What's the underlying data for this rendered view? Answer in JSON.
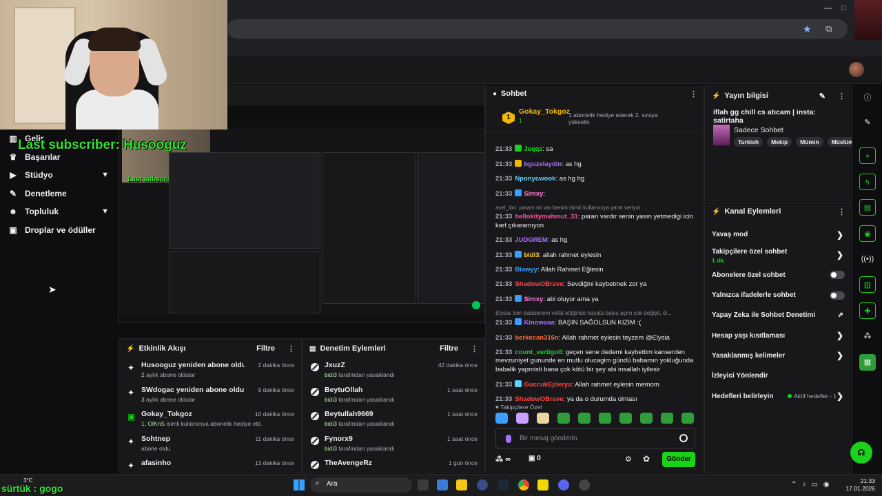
{
  "overlay": {
    "last_subscriber": "Last subscriber: Husooguz",
    "bottom_text": "sürtük : gogo",
    "weather_temp": "3°C"
  },
  "nav": {
    "items": [
      {
        "label": "Gelir",
        "icon": "chart-icon",
        "has_chevron": false
      },
      {
        "label": "Başarılar",
        "icon": "trophy-icon",
        "has_chevron": false
      },
      {
        "label": "Stüdyo",
        "icon": "video-icon",
        "has_chevron": true
      },
      {
        "label": "Denetleme",
        "icon": "wrench-icon",
        "has_chevron": false
      },
      {
        "label": "Topluluk",
        "icon": "people-icon",
        "has_chevron": true
      },
      {
        "label": "Droplar ve ödüller",
        "icon": "gift-icon",
        "has_chevron": false
      }
    ]
  },
  "activity": {
    "title": "Etkinlik Akışı",
    "filter": "Filtre",
    "rows": [
      {
        "title": "Husooguz yeniden abone oldu!",
        "sub_accent": "2",
        "sub": "aylık abone oldular",
        "time": "2 dakika önce"
      },
      {
        "title": "SWdogac yeniden abone oldu!",
        "sub_accent": "3",
        "sub": "aylık abone oldular",
        "time": "9 dakika önce"
      },
      {
        "title": "Gokay_Tokgoz",
        "sub_accent": "1, OlKnS",
        "sub": "isimli kullanıcıya abonelik hediye etti.",
        "time": "10 dakika önce"
      },
      {
        "title": "Sohtnep",
        "sub_accent": "",
        "sub": "abone oldu",
        "time": "11 dakika önce"
      },
      {
        "title": "afasinho",
        "sub_accent": "",
        "sub": "",
        "time": "13 dakika önce"
      }
    ]
  },
  "moderation": {
    "title": "Denetim Eylemleri",
    "filter": "Filtre",
    "rows": [
      {
        "title": "JxuzZ",
        "by": "bidi3",
        "sub": "tarafından yasaklandı",
        "time": "42 dakika önce"
      },
      {
        "title": "BeytuOllah",
        "by": "bidi3",
        "sub": "tarafından yasaklandı",
        "time": "1 saat önce"
      },
      {
        "title": "Beytullah9669",
        "by": "bidi3",
        "sub": "tarafından yasaklandı",
        "time": "1 saat önce"
      },
      {
        "title": "Fynorx9",
        "by": "bidi3",
        "sub": "tarafından yasaklandı",
        "time": "1 saat önce"
      },
      {
        "title": "TheAvengeRz",
        "by": "",
        "sub": "",
        "time": "1 gün önce"
      }
    ]
  },
  "chat": {
    "title": "Sohbet",
    "pinned": {
      "user": "Gokay_Tokgoz",
      "rank": "1",
      "count": "1",
      "text": "1 abonelik hediye ederek 2. sıraya yükselin"
    },
    "messages": [
      {
        "time": "21:33",
        "user": "Jeqqz",
        "color": "#1ad21a",
        "badge": "#1ad21a",
        "text": "sa"
      },
      {
        "time": "21:33",
        "user": "bguzelaydin",
        "color": "#a970ff",
        "badge": "#f5b800",
        "text": "as hg"
      },
      {
        "time": "21:33",
        "user": "Nponycwook",
        "color": "#5fd3ff",
        "badge": "",
        "text": "as hg hg"
      },
      {
        "time": "21:33",
        "user": "Simxy",
        "color": "#ff7ad9",
        "badge": "#3aa0ff",
        "text": ""
      },
      {
        "reply": "avel_ibo: param mi var benim isimli kullanıcıya yanıt veriyor"
      },
      {
        "time": "21:33",
        "user": "hellokitymahmut_31",
        "color": "#ff4fa3",
        "badge": "",
        "text": "paran vardır senin yasın yetmedigi icin kart çıkaramıyon"
      },
      {
        "time": "21:33",
        "user": "JUDGREM",
        "color": "#a970ff",
        "badge": "",
        "text": "as hg"
      },
      {
        "time": "21:33",
        "user": "bidi3",
        "color": "#ffd23f",
        "badge": "#3aa0ff",
        "text": "allah rahmet eylesin"
      },
      {
        "time": "21:33",
        "user": "Biawyy",
        "color": "#3aa0ff",
        "badge": "",
        "text": "Allah Rahmet Eğlesin"
      },
      {
        "time": "21:33",
        "user": "ShadowOBrave",
        "color": "#ff4444",
        "badge": "",
        "text": "Sevdiğini kaybetmek zor ya"
      },
      {
        "time": "21:33",
        "user": "Simxy",
        "color": "#ff7ad9",
        "badge": "#3aa0ff",
        "text": "abi oluyor ama ya"
      },
      {
        "reply": "Elysia: ben babannem vefat ettiğinde hayata bakış açım çok değişti, öl..."
      },
      {
        "time": "21:33",
        "user": "Kinowaaa",
        "color": "#a970ff",
        "badge": "#3aa0ff",
        "text": "BAŞIN SAĞOLSUN KIZIM :("
      },
      {
        "time": "21:33",
        "user": "berkecan316n",
        "color": "#ff6a3d",
        "badge": "",
        "text": "Allah rahmet eylesin teyzem @Elysia"
      },
      {
        "time": "21:33",
        "user": "count_vertigo0",
        "color": "#1ad21a",
        "badge": "",
        "text": "geçen sene dedemi kaybettim kanserden mevzuniyet gununde en mutlu olucagim gündü babamın yokluğunda babalik yapmisti bana çok kötü bir şey abi insallah iyilesir"
      },
      {
        "time": "21:33",
        "user": "GuccukEjderya",
        "color": "#ff4444",
        "badge": "#5fd3ff",
        "text": "Allah rahmet eylesin memom"
      },
      {
        "time": "21:33",
        "user": "ShadowOBrave",
        "color": "#ff4444",
        "badge": "",
        "text": "ya da o durumda olması"
      }
    ],
    "followers_only": "Takipçilere Özel",
    "input_placeholder": "Bir mesaj gönderin",
    "points": "∞",
    "gifts": "0",
    "send_label": "Gönder"
  },
  "stream_info": {
    "title": "Yayın bilgisi",
    "stream_title": "iflah gg chill cs atıcam | insta: satirtaha",
    "category": "Sadece Sohbet",
    "tags": [
      "Turkish",
      "Mekip",
      "Mümin",
      "Müslüm"
    ]
  },
  "channel_actions": {
    "title": "Kanal Eylemleri",
    "rows": [
      {
        "label": "Yavaş mod",
        "sub": "",
        "control": "chevron"
      },
      {
        "label": "Takipçilere özel sohbet",
        "sub": "1 dk.",
        "control": "chevron"
      },
      {
        "label": "Abonelere özel sohbet",
        "sub": "",
        "control": "toggle"
      },
      {
        "label": "Yalnızca ifadelerle sohbet",
        "sub": "",
        "control": "toggle"
      },
      {
        "label": "Yapay Zeka ile Sohbet Denetimi",
        "sub": "",
        "control": "external"
      },
      {
        "label": "Hesap yaşı kısıtlaması",
        "sub": "",
        "control": "chevron"
      },
      {
        "label": "Yasaklanmış kelimeler",
        "sub": "",
        "control": "chevron"
      },
      {
        "label": "İzleyici Yönlendir",
        "sub": "",
        "control": "none"
      },
      {
        "label": "Hedefleri belirleyin",
        "sub": "",
        "control": "status",
        "status": "Aktif hedefler - 1"
      }
    ]
  },
  "taskbar": {
    "search": "Ara",
    "time": "21:33",
    "date": "17.01.2026"
  },
  "colors": {
    "accent_green": "#1ad21a",
    "background": "#0e0e10",
    "panel": "#18181b"
  }
}
